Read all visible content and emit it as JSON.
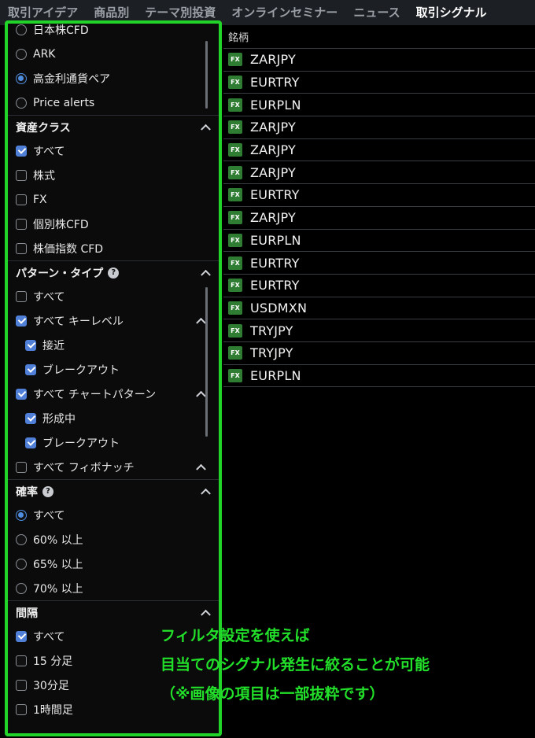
{
  "nav": {
    "tabs": [
      "取引アイデア",
      "商品別",
      "テーマ別投資",
      "オンラインセミナー",
      "ニュース",
      "取引シグナル"
    ],
    "active_index": 5
  },
  "filters": {
    "top_list": [
      {
        "label": "日本株CFD",
        "selected": false
      },
      {
        "label": "ARK",
        "selected": false
      },
      {
        "label": "高金利通貨ペア",
        "selected": true
      },
      {
        "label": "Price alerts",
        "selected": false
      }
    ],
    "asset_class": {
      "title": "資産クラス",
      "items": [
        {
          "label": "すべて",
          "checked": true
        },
        {
          "label": "株式",
          "checked": false
        },
        {
          "label": "FX",
          "checked": false
        },
        {
          "label": "個別株CFD",
          "checked": false
        },
        {
          "label": "株価指数 CFD",
          "checked": false
        }
      ]
    },
    "pattern_type": {
      "title": "パターン・タイプ",
      "items": [
        {
          "label": "すべて",
          "checked": false,
          "indent": false,
          "expand": false
        },
        {
          "label": "すべて キーレベル",
          "checked": true,
          "indent": false,
          "expand": true
        },
        {
          "label": "接近",
          "checked": true,
          "indent": true,
          "expand": false
        },
        {
          "label": "ブレークアウト",
          "checked": true,
          "indent": true,
          "expand": false
        },
        {
          "label": "すべて チャートパターン",
          "checked": true,
          "indent": false,
          "expand": true
        },
        {
          "label": "形成中",
          "checked": true,
          "indent": true,
          "expand": false
        },
        {
          "label": "ブレークアウト",
          "checked": true,
          "indent": true,
          "expand": false
        },
        {
          "label": "すべて フィボナッチ",
          "checked": false,
          "indent": false,
          "expand": true
        }
      ]
    },
    "probability": {
      "title": "確率",
      "items": [
        {
          "label": "すべて",
          "selected": true
        },
        {
          "label": "60% 以上",
          "selected": false
        },
        {
          "label": "65% 以上",
          "selected": false
        },
        {
          "label": "70% 以上",
          "selected": false
        }
      ]
    },
    "interval": {
      "title": "間隔",
      "items": [
        {
          "label": "すべて",
          "checked": true
        },
        {
          "label": "15 分足",
          "checked": false
        },
        {
          "label": "30分足",
          "checked": false
        },
        {
          "label": "1時間足",
          "checked": false
        }
      ]
    }
  },
  "signals": {
    "header": "銘柄",
    "badge": "FX",
    "rows": [
      "ZARJPY",
      "EURTRY",
      "EURPLN",
      "ZARJPY",
      "ZARJPY",
      "ZARJPY",
      "EURTRY",
      "ZARJPY",
      "EURPLN",
      "EURTRY",
      "EURTRY",
      "USDMXN",
      "TRYJPY",
      "TRYJPY",
      "EURPLN"
    ]
  },
  "annotation": {
    "line1": "フィルタ設定を使えば",
    "line2": "目当てのシグナル発生に絞ることが可能",
    "line3": "（※画像の項目は一部抜粋です）",
    "color": "#22e02a"
  },
  "colors": {
    "accent_blue": "#4f7fd6",
    "fx_badge": "#2f7d32",
    "highlight_green": "#22d32a"
  }
}
